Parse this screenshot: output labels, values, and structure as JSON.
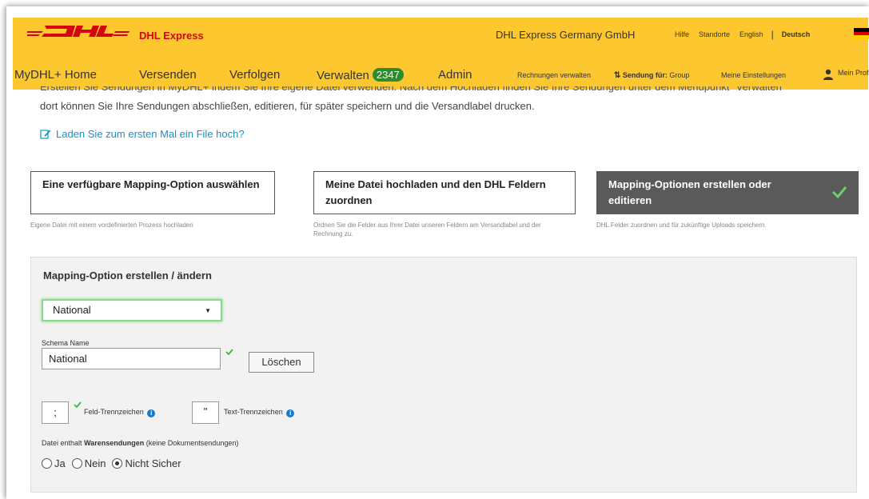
{
  "header": {
    "brand": "DHL Express",
    "company": "DHL Express Germany GmbH",
    "links": [
      "Hilfe",
      "Standorte",
      "English",
      "|",
      "Deutsch"
    ],
    "colors": {
      "yellow": "#fdc82f",
      "red": "#d40511"
    }
  },
  "nav": {
    "home": "MyDHL+ Home",
    "send": "Versenden",
    "track": "Verfolgen",
    "manage": "Verwalten",
    "manage_count": "2347",
    "admin": "Admin",
    "invoices": "Rechnungen verwalten",
    "shipment_for_label": "Sendung für:",
    "shipment_for_value": "Group",
    "settings": "Meine Einstellungen",
    "profile": "Mein Profil"
  },
  "intro": {
    "cut_line": "Erstellen Sie Sendungen in MyDHL+ indem Sie Ihre eigene Datei verwenden. Nach dem Hochladen finden Sie Ihre Sendungen unter dem Menüpunkt \"Verwalten\"",
    "line": "dort können Sie Ihre Sendungen abschließen, editieren, für später speichern und die Versandlabel drucken.",
    "first_upload_link": "Laden Sie zum ersten Mal ein File hoch?"
  },
  "steps": [
    {
      "title": "Eine verfügbare Mapping-Option auswählen",
      "desc": "Eigene Datei mit einem vordefinierten Prozess hochladen"
    },
    {
      "title": "Meine Datei hochladen und den DHL Feldern zuordnen",
      "desc": "Ordnen Sie die Felder aus Ihrer Datei unseren Feldern am Versandlabel und der Rechnung zu."
    },
    {
      "title": "Mapping-Optionen erstellen oder editieren",
      "desc": "DHL Felder zuordnen und für zukünftige Uploads speichern."
    }
  ],
  "form": {
    "title": "Mapping-Option erstellen / ändern",
    "selected_option": "National",
    "schema_label": "Schema Name",
    "schema_value": "National",
    "delete_button": "Löschen",
    "field_sep_value": ";",
    "field_sep_label": "Feld-Trennzeichen",
    "text_sep_value": "\"",
    "text_sep_label": "Text-Trennzeichen",
    "goods_prefix": "Datei enthalt",
    "goods_bold": "Warensendungen",
    "goods_suffix": "(keine Dokumentsendungen)",
    "radio_options": [
      "Ja",
      "Nein",
      "Nicht Sicher"
    ],
    "radio_selected": "Nicht Sicher"
  }
}
